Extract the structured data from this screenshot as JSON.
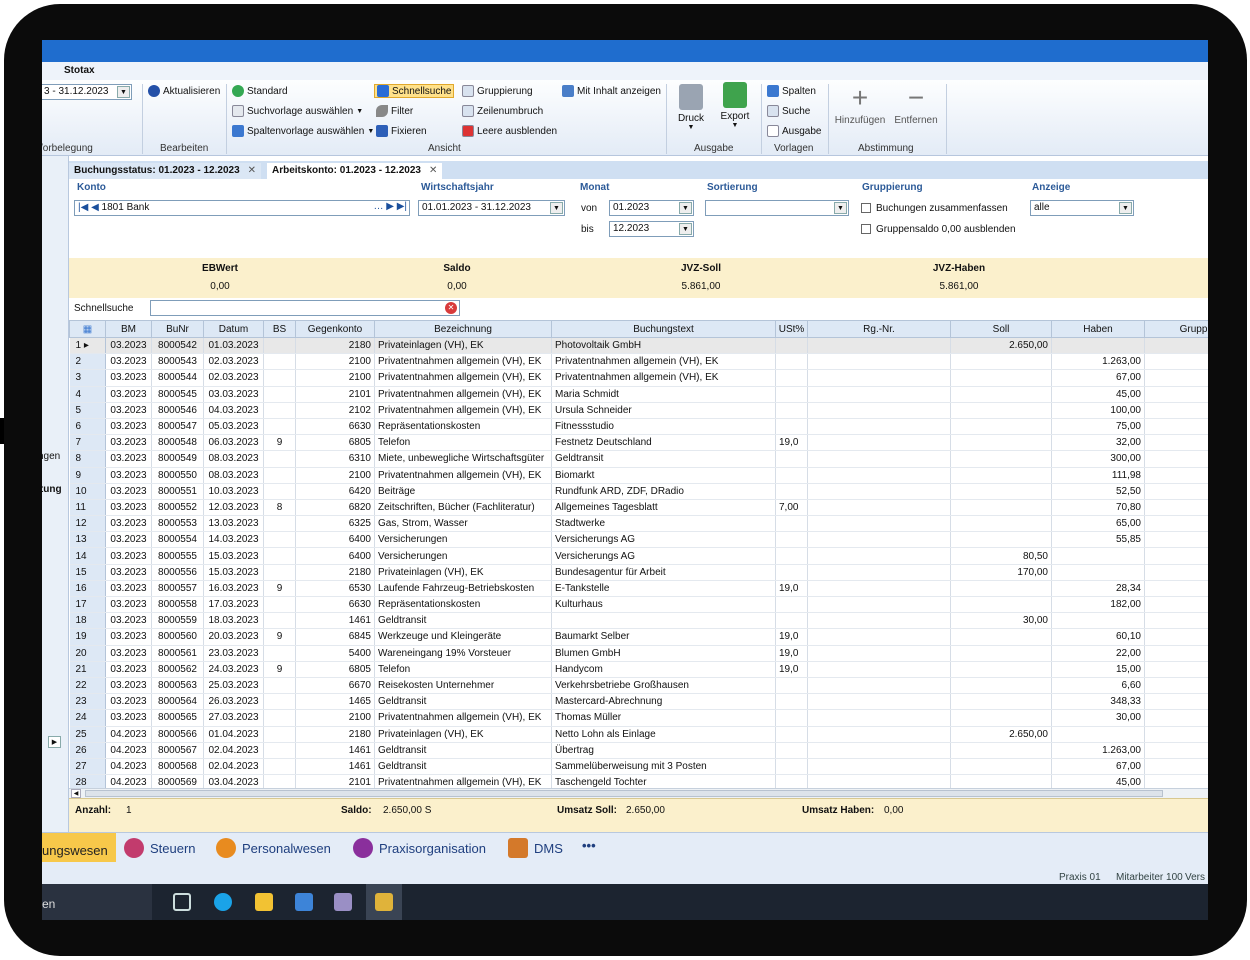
{
  "app": {
    "menu_title": "Stotax"
  },
  "ribbon": {
    "date_range": "3 - 31.12.2023",
    "aktualisieren": "Aktualisieren",
    "standard": "Standard",
    "suchvorlage": "Suchvorlage auswählen",
    "spaltenvorlage": "Spaltenvorlage auswählen",
    "schnellsuche": "Schnellsuche",
    "filter": "Filter",
    "fixieren": "Fixieren",
    "gruppierung": "Gruppierung",
    "zeilenumbruch": "Zeilenumbruch",
    "leere_ausblenden": "Leere ausblenden",
    "mit_inhalt": "Mit Inhalt anzeigen",
    "druck": "Druck",
    "export": "Export",
    "spalten": "Spalten",
    "suche": "Suche",
    "ausgabe_btn": "Ausgabe",
    "hinzufuegen": "Hinzufügen",
    "entfernen": "Entfernen",
    "groups": {
      "vorbelegung": "/orbelegung",
      "bearbeiten": "Bearbeiten",
      "ansicht": "Ansicht",
      "ausgabe": "Ausgabe",
      "vorlagen": "Vorlagen",
      "abstimmung": "Abstimmung"
    }
  },
  "tabs": [
    {
      "label": "Buchungsstatus: 01.2023 - 12.2023"
    },
    {
      "label": "Arbeitskonto: 01.2023 - 12.2023"
    }
  ],
  "filters": {
    "konto_label": "Konto",
    "konto_value": "1801 Bank",
    "wj_label": "Wirtschaftsjahr",
    "wj_value": "01.01.2023 - 31.12.2023",
    "monat_label": "Monat",
    "von_label": "von",
    "von_value": "01.2023",
    "bis_label": "bis",
    "bis_value": "12.2023",
    "sortierung_label": "Sortierung",
    "sortierung_value": "",
    "gruppierung_label": "Gruppierung",
    "opt1": "Buchungen zusammenfassen",
    "opt2": "Gruppensaldo 0,00 ausblenden",
    "anzeige_label": "Anzeige",
    "anzeige_value": "alle"
  },
  "summary": {
    "eb_label": "EBWert",
    "eb_value": "0,00",
    "saldo_label": "Saldo",
    "saldo_value": "0,00",
    "soll_label": "JVZ-Soll",
    "soll_value": "5.861,00",
    "haben_label": "JVZ-Haben",
    "haben_value": "5.861,00"
  },
  "schnellsuche_label": "Schnellsuche",
  "table": {
    "columns": [
      "BM",
      "BuNr",
      "Datum",
      "BS",
      "Gegenkonto",
      "Bezeichnung",
      "Buchungstext",
      "USt%",
      "Rg.-Nr.",
      "Soll",
      "Haben",
      "Grupp"
    ],
    "rows": [
      [
        "03.2023",
        "8000542",
        "01.03.2023",
        "",
        "2180",
        "Privateinlagen (VH), EK",
        "Photovoltaik GmbH",
        "",
        "",
        "2.650,00",
        ""
      ],
      [
        "03.2023",
        "8000543",
        "02.03.2023",
        "",
        "2100",
        "Privatentnahmen allgemein (VH), EK",
        "Privatentnahmen allgemein (VH), EK",
        "",
        "",
        "",
        "1.263,00"
      ],
      [
        "03.2023",
        "8000544",
        "02.03.2023",
        "",
        "2100",
        "Privatentnahmen allgemein (VH), EK",
        "Privatentnahmen allgemein (VH), EK",
        "",
        "",
        "",
        "67,00"
      ],
      [
        "03.2023",
        "8000545",
        "03.03.2023",
        "",
        "2101",
        "Privatentnahmen allgemein (VH), EK",
        "Maria Schmidt",
        "",
        "",
        "",
        "45,00"
      ],
      [
        "03.2023",
        "8000546",
        "04.03.2023",
        "",
        "2102",
        "Privatentnahmen allgemein (VH), EK",
        "Ursula Schneider",
        "",
        "",
        "",
        "100,00"
      ],
      [
        "03.2023",
        "8000547",
        "05.03.2023",
        "",
        "6630",
        "Repräsentationskosten",
        "Fitnessstudio",
        "",
        "",
        "",
        "75,00"
      ],
      [
        "03.2023",
        "8000548",
        "06.03.2023",
        "9",
        "6805",
        "Telefon",
        "Festnetz Deutschland",
        "19,0",
        "",
        "",
        "32,00"
      ],
      [
        "03.2023",
        "8000549",
        "08.03.2023",
        "",
        "6310",
        "Miete, unbewegliche Wirtschaftsgüter",
        "Geldtransit",
        "",
        "",
        "",
        "300,00"
      ],
      [
        "03.2023",
        "8000550",
        "08.03.2023",
        "",
        "2100",
        "Privatentnahmen allgemein (VH), EK",
        "Biomarkt",
        "",
        "",
        "",
        "111,98"
      ],
      [
        "03.2023",
        "8000551",
        "10.03.2023",
        "",
        "6420",
        "Beiträge",
        "Rundfunk ARD, ZDF, DRadio",
        "",
        "",
        "",
        "52,50"
      ],
      [
        "03.2023",
        "8000552",
        "12.03.2023",
        "8",
        "6820",
        "Zeitschriften, Bücher (Fachliteratur)",
        "Allgemeines Tagesblatt",
        "7,00",
        "",
        "",
        "70,80"
      ],
      [
        "03.2023",
        "8000553",
        "13.03.2023",
        "",
        "6325",
        "Gas, Strom, Wasser",
        "Stadtwerke",
        "",
        "",
        "",
        "65,00"
      ],
      [
        "03.2023",
        "8000554",
        "14.03.2023",
        "",
        "6400",
        "Versicherungen",
        "Versicherungs AG",
        "",
        "",
        "",
        "55,85"
      ],
      [
        "03.2023",
        "8000555",
        "15.03.2023",
        "",
        "6400",
        "Versicherungen",
        "Versicherungs AG",
        "",
        "",
        "80,50",
        ""
      ],
      [
        "03.2023",
        "8000556",
        "15.03.2023",
        "",
        "2180",
        "Privateinlagen (VH), EK",
        "Bundesagentur für Arbeit",
        "",
        "",
        "170,00",
        ""
      ],
      [
        "03.2023",
        "8000557",
        "16.03.2023",
        "9",
        "6530",
        "Laufende Fahrzeug-Betriebskosten",
        "E-Tankstelle",
        "19,0",
        "",
        "",
        "28,34"
      ],
      [
        "03.2023",
        "8000558",
        "17.03.2023",
        "",
        "6630",
        "Repräsentationskosten",
        "Kulturhaus",
        "",
        "",
        "",
        "182,00"
      ],
      [
        "03.2023",
        "8000559",
        "18.03.2023",
        "",
        "1461",
        "Geldtransit",
        "",
        "",
        "",
        "30,00",
        ""
      ],
      [
        "03.2023",
        "8000560",
        "20.03.2023",
        "9",
        "6845",
        "Werkzeuge und Kleingeräte",
        "Baumarkt Selber",
        "19,0",
        "",
        "",
        "60,10"
      ],
      [
        "03.2023",
        "8000561",
        "23.03.2023",
        "",
        "5400",
        "Wareneingang 19% Vorsteuer",
        "Blumen GmbH",
        "19,0",
        "",
        "",
        "22,00"
      ],
      [
        "03.2023",
        "8000562",
        "24.03.2023",
        "9",
        "6805",
        "Telefon",
        "Handycom",
        "19,0",
        "",
        "",
        "15,00"
      ],
      [
        "03.2023",
        "8000563",
        "25.03.2023",
        "",
        "6670",
        "Reisekosten Unternehmer",
        "Verkehrsbetriebe Großhausen",
        "",
        "",
        "",
        "6,60"
      ],
      [
        "03.2023",
        "8000564",
        "26.03.2023",
        "",
        "1465",
        "Geldtransit",
        "Mastercard-Abrechnung",
        "",
        "",
        "",
        "348,33"
      ],
      [
        "03.2023",
        "8000565",
        "27.03.2023",
        "",
        "2100",
        "Privatentnahmen allgemein (VH), EK",
        "Thomas Müller",
        "",
        "",
        "",
        "30,00"
      ],
      [
        "04.2023",
        "8000566",
        "01.04.2023",
        "",
        "2180",
        "Privateinlagen (VH), EK",
        "Netto Lohn als Einlage",
        "",
        "",
        "2.650,00",
        ""
      ],
      [
        "04.2023",
        "8000567",
        "02.04.2023",
        "",
        "1461",
        "Geldtransit",
        "Übertrag",
        "",
        "",
        "",
        "1.263,00"
      ],
      [
        "04.2023",
        "8000568",
        "02.04.2023",
        "",
        "1461",
        "Geldtransit",
        "Sammelüberweisung mit 3 Posten",
        "",
        "",
        "",
        "67,00"
      ],
      [
        "04.2023",
        "8000569",
        "03.04.2023",
        "",
        "2101",
        "Privatentnahmen allgemein (VH), EK",
        "Taschengeld Tochter",
        "",
        "",
        "",
        "45,00"
      ]
    ]
  },
  "footer": {
    "anzahl_label": "Anzahl:",
    "anzahl_value": "1",
    "saldo_label": "Saldo:",
    "saldo_value": "2.650,00 S",
    "soll_label": "Umsatz Soll:",
    "soll_value": "2.650,00",
    "haben_label": "Umsatz Haben:",
    "haben_value": "0,00"
  },
  "sidebar_fragments": {
    "a": "ngen",
    "b": "rtung"
  },
  "modules": [
    {
      "label": "ungswesen"
    },
    {
      "label": "Steuern"
    },
    {
      "label": "Personalwesen"
    },
    {
      "label": "Praxisorganisation"
    },
    {
      "label": "DMS"
    },
    {
      "label": "•••"
    }
  ],
  "status": {
    "praxis": "Praxis 01",
    "mitarbeiter": "Mitarbeiter 100",
    "vers": "Vers"
  },
  "taskbar": {
    "search_fragment": "en"
  }
}
